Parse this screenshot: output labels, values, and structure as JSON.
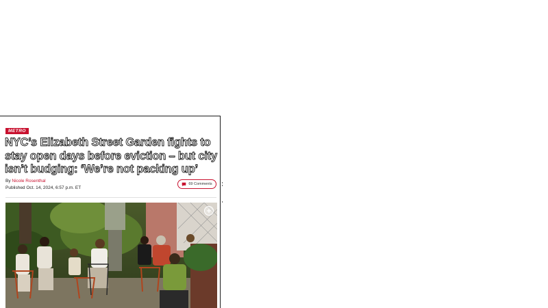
{
  "article": {
    "section": "METRO",
    "headline": "NYC’s Elizabeth Street Garden fights to stay open days before eviction – but city isn’t budging: ‘We’re not packing up’",
    "byline_prefix": "By",
    "author": "Nicole Rosenthal",
    "published": "Published Oct. 14, 2024, 6:57 p.m. ET",
    "comments_label": "69 Comments"
  },
  "icons": {
    "comments": "comment-bubble-icon",
    "zoom": "expand-plus-icon"
  },
  "colors": {
    "accent": "#c8102e",
    "text": "#222222"
  }
}
